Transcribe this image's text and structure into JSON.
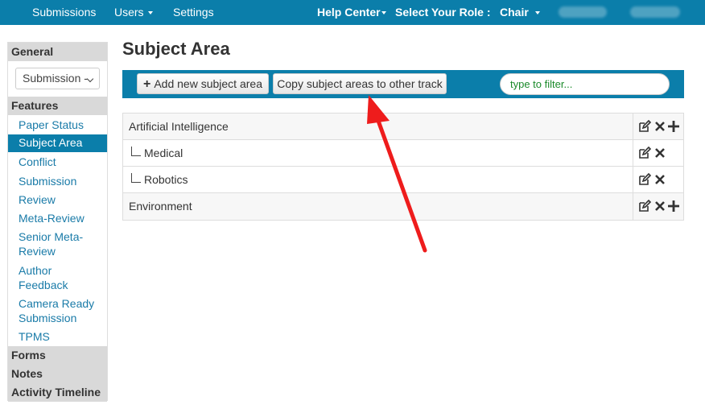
{
  "navbar": {
    "items": [
      {
        "label": "Submissions"
      },
      {
        "label": "Users"
      },
      {
        "label": "Settings"
      }
    ],
    "help_center": "Help Center",
    "role_label": "Select Your Role :",
    "role_value": "Chair"
  },
  "sidebar": {
    "general_header": "General",
    "select_value": "Submission -",
    "features_header": "Features",
    "links": [
      {
        "label": "Paper Status"
      },
      {
        "label": "Subject Area"
      },
      {
        "label": "Conflict"
      },
      {
        "label": "Submission"
      },
      {
        "label": "Review"
      },
      {
        "label": "Meta-Review"
      },
      {
        "label": "Senior Meta-\nReview"
      },
      {
        "label": "Author\nFeedback"
      },
      {
        "label": "Camera Ready\nSubmission"
      },
      {
        "label": "TPMS"
      }
    ],
    "forms_header": "Forms",
    "notes_header": "Notes",
    "activity_header": "Activity Timeline"
  },
  "main": {
    "title": "Subject Area",
    "add_button": "Add new subject area",
    "copy_button": "Copy subject areas to other track",
    "filter_placeholder": "type to filter..."
  },
  "tree": [
    {
      "label": "Artificial Intelligence",
      "level": 0,
      "can_add": true
    },
    {
      "label": "Medical",
      "level": 1,
      "can_add": false
    },
    {
      "label": "Robotics",
      "level": 1,
      "can_add": false
    },
    {
      "label": "Environment",
      "level": 0,
      "can_add": true
    }
  ],
  "colors": {
    "brand": "#0b7eaa",
    "link": "#1a7ba8",
    "annotation_arrow": "#ee1c1c"
  }
}
